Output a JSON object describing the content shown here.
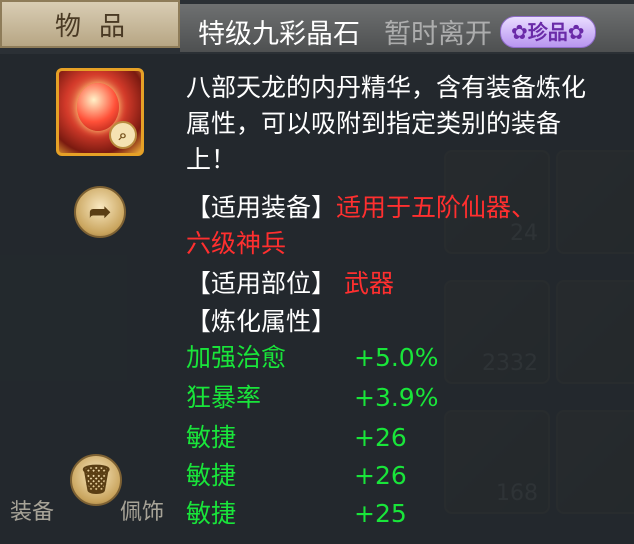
{
  "header": {
    "tab_label": "物品",
    "item_name": "特级九彩晶石",
    "name_ghost": "暂时离开",
    "rarity_badge": "珍品"
  },
  "item": {
    "icon": "red-crystal-gem-icon",
    "zoom_icon": "magnifier-icon",
    "description": "八部天龙的内丹精华，含有装备炼化属性，可以吸附到指定类别的装备上！",
    "applicable_equipment_label": "【适用装备】",
    "applicable_equipment_value_1": "适用于五阶仙器、",
    "applicable_equipment_value_2": "六级神兵",
    "applicable_slot_label": "【适用部位】",
    "applicable_slot_value": "武器",
    "refine_attr_label": "【炼化属性】",
    "stats": [
      {
        "name": "加强治愈",
        "value": "+5.0%"
      },
      {
        "name": "狂暴率",
        "value": "+3.9%"
      },
      {
        "name": "敏捷",
        "value": "+26"
      },
      {
        "name": "敏捷",
        "value": "+26"
      },
      {
        "name": "敏捷",
        "value": "+25"
      }
    ]
  },
  "actions": {
    "share_icon": "share-icon",
    "discard_icon": "trash-can-icon"
  },
  "background": {
    "slot_counts": [
      "24",
      "2332",
      "168"
    ],
    "bottom_labels": [
      "装备",
      "佩饰"
    ]
  },
  "colors": {
    "text_white": "#ffffff",
    "text_red": "#ff2f2f",
    "text_green": "#19e53a",
    "rarity_purple": "#6a2aa8",
    "icon_border": "#e6a126"
  }
}
